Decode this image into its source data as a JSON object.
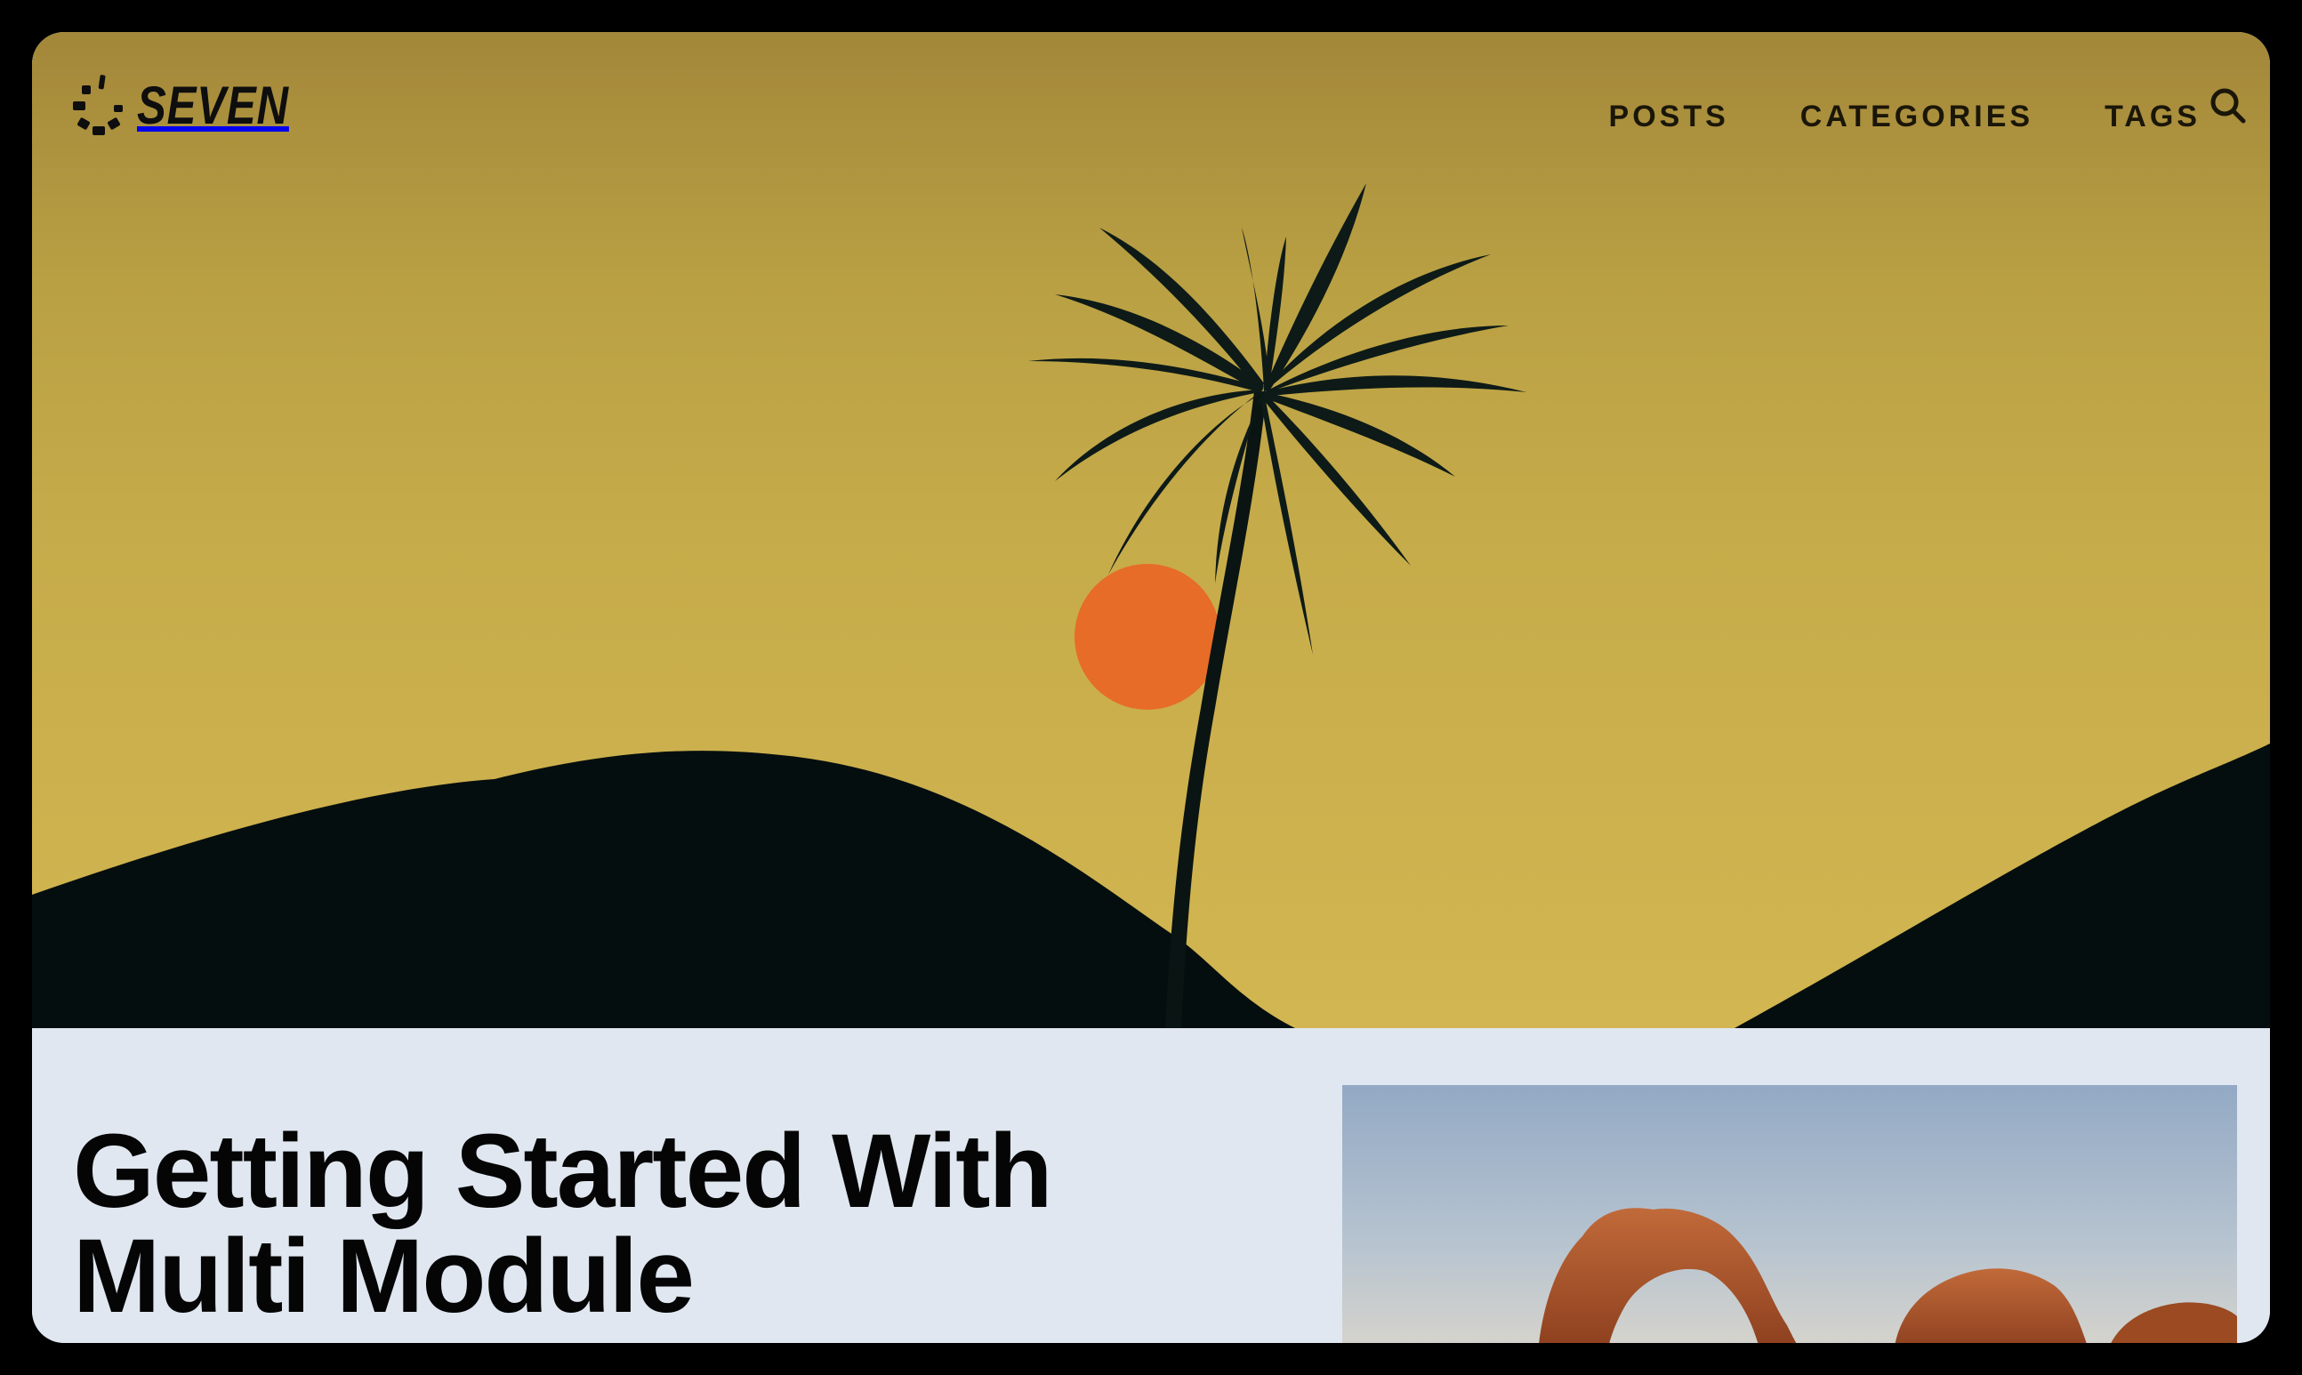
{
  "logo": {
    "text": "SEVEN",
    "icon": "loading-spinner-icon"
  },
  "nav": {
    "items": [
      {
        "label": "POSTS"
      },
      {
        "label": "CATEGORIES"
      },
      {
        "label": "TAGS"
      }
    ],
    "search_icon": "search-icon"
  },
  "hero": {
    "image": "palm-tree-sunset-illustration",
    "colors": {
      "sky_top": "#a3873a",
      "sky_mid": "#c6aa4a",
      "sun": "#e66c27",
      "hills": "#050e0f"
    }
  },
  "post": {
    "title_line1": "Getting Started With",
    "title_line2": "Multi Module",
    "image": "desert-rock-arch-photo"
  }
}
